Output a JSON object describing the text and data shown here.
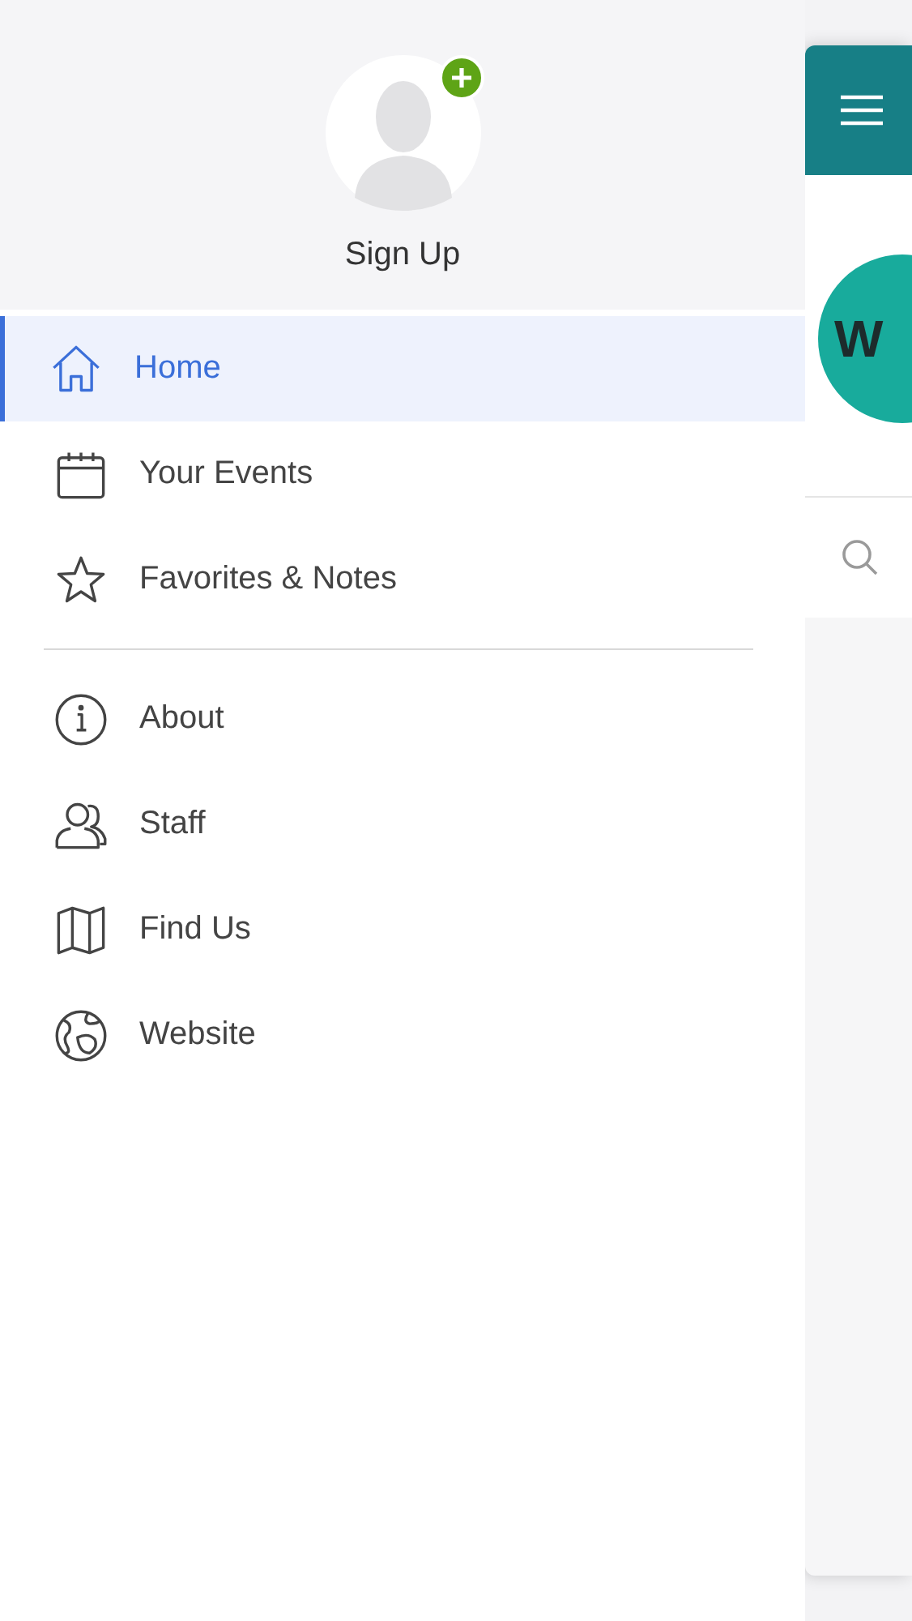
{
  "profile": {
    "label": "Sign Up"
  },
  "menu_sections": [
    {
      "items": [
        {
          "label": "Home",
          "kind": "home",
          "selected": true
        },
        {
          "label": "Your Events",
          "kind": "calendar",
          "selected": false
        },
        {
          "label": "Favorites & Notes",
          "kind": "star",
          "selected": false
        }
      ]
    },
    {
      "items": [
        {
          "label": "About",
          "kind": "info",
          "selected": false
        },
        {
          "label": "Staff",
          "kind": "people",
          "selected": false
        },
        {
          "label": "Find Us",
          "kind": "map",
          "selected": false
        },
        {
          "label": "Website",
          "kind": "globe",
          "selected": false
        }
      ]
    }
  ],
  "main_panel": {
    "logo": {
      "text": "W"
    }
  }
}
